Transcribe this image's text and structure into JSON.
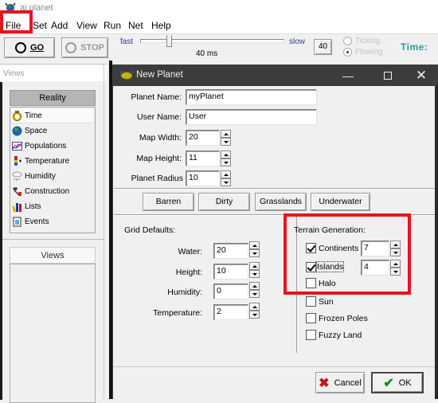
{
  "app": {
    "title": "ai.planet",
    "menu": [
      "File",
      "Set",
      "Add",
      "View",
      "Run",
      "Net",
      "Help"
    ]
  },
  "toolbar": {
    "go_label": "GO",
    "stop_label": "STOP",
    "speed_fast": "fast",
    "speed_slow": "slow",
    "speed_ms": "40 ms",
    "speed_value": "40",
    "speed_slider_fraction": 0.18,
    "mode_ticking": "Ticking",
    "mode_flowing": "Flowing",
    "mode_selected": "Flowing",
    "time_label": "Time:"
  },
  "views_panel": {
    "header": "Views",
    "reality_header": "Reality",
    "reality_items": [
      {
        "label": "Time",
        "icon": "stopwatch-icon"
      },
      {
        "label": "Space",
        "icon": "globe-icon"
      },
      {
        "label": "Populations",
        "icon": "chart-icon"
      },
      {
        "label": "Temperature",
        "icon": "thermometer-icon"
      },
      {
        "label": "Humidity",
        "icon": "cloud-rain-icon"
      },
      {
        "label": "Construction",
        "icon": "hammer-icon"
      },
      {
        "label": "Lists",
        "icon": "books-icon"
      },
      {
        "label": "Events",
        "icon": "notepad-icon"
      }
    ],
    "views_header": "Views"
  },
  "dialog": {
    "title": "New Planet",
    "fields": {
      "planet_name": {
        "label": "Planet Name:",
        "value": "myPlanet"
      },
      "user_name": {
        "label": "User Name:",
        "value": "User"
      },
      "map_width": {
        "label": "Map Width:",
        "value": "20"
      },
      "map_height": {
        "label": "Map Height:",
        "value": "11"
      },
      "planet_radius": {
        "label": "Planet Radius",
        "value": "10"
      }
    },
    "presets": [
      "Barren",
      "Dirty",
      "Grasslands",
      "Underwater"
    ],
    "grid_defaults": {
      "title": "Grid Defaults:",
      "water": {
        "label": "Water:",
        "value": "20"
      },
      "height": {
        "label": "Height:",
        "value": "10"
      },
      "humidity": {
        "label": "Humidity:",
        "value": "0"
      },
      "temperature": {
        "label": "Temperature:",
        "value": "2"
      }
    },
    "terrain": {
      "title": "Terrain Generation:",
      "continents": {
        "label": "Continents",
        "checked": true,
        "value": "7"
      },
      "islands": {
        "label": "Islands",
        "checked": true,
        "value": "4"
      },
      "halo": {
        "label": "Halo",
        "checked": false
      },
      "sun": {
        "label": "Sun",
        "checked": false
      },
      "frozen_poles": {
        "label": "Frozen Poles",
        "checked": false
      },
      "fuzzy_land": {
        "label": "Fuzzy Land",
        "checked": false
      }
    },
    "cancel_label": "Cancel",
    "ok_label": "OK"
  },
  "annotations": {
    "highlight_color": "#e8141a"
  }
}
